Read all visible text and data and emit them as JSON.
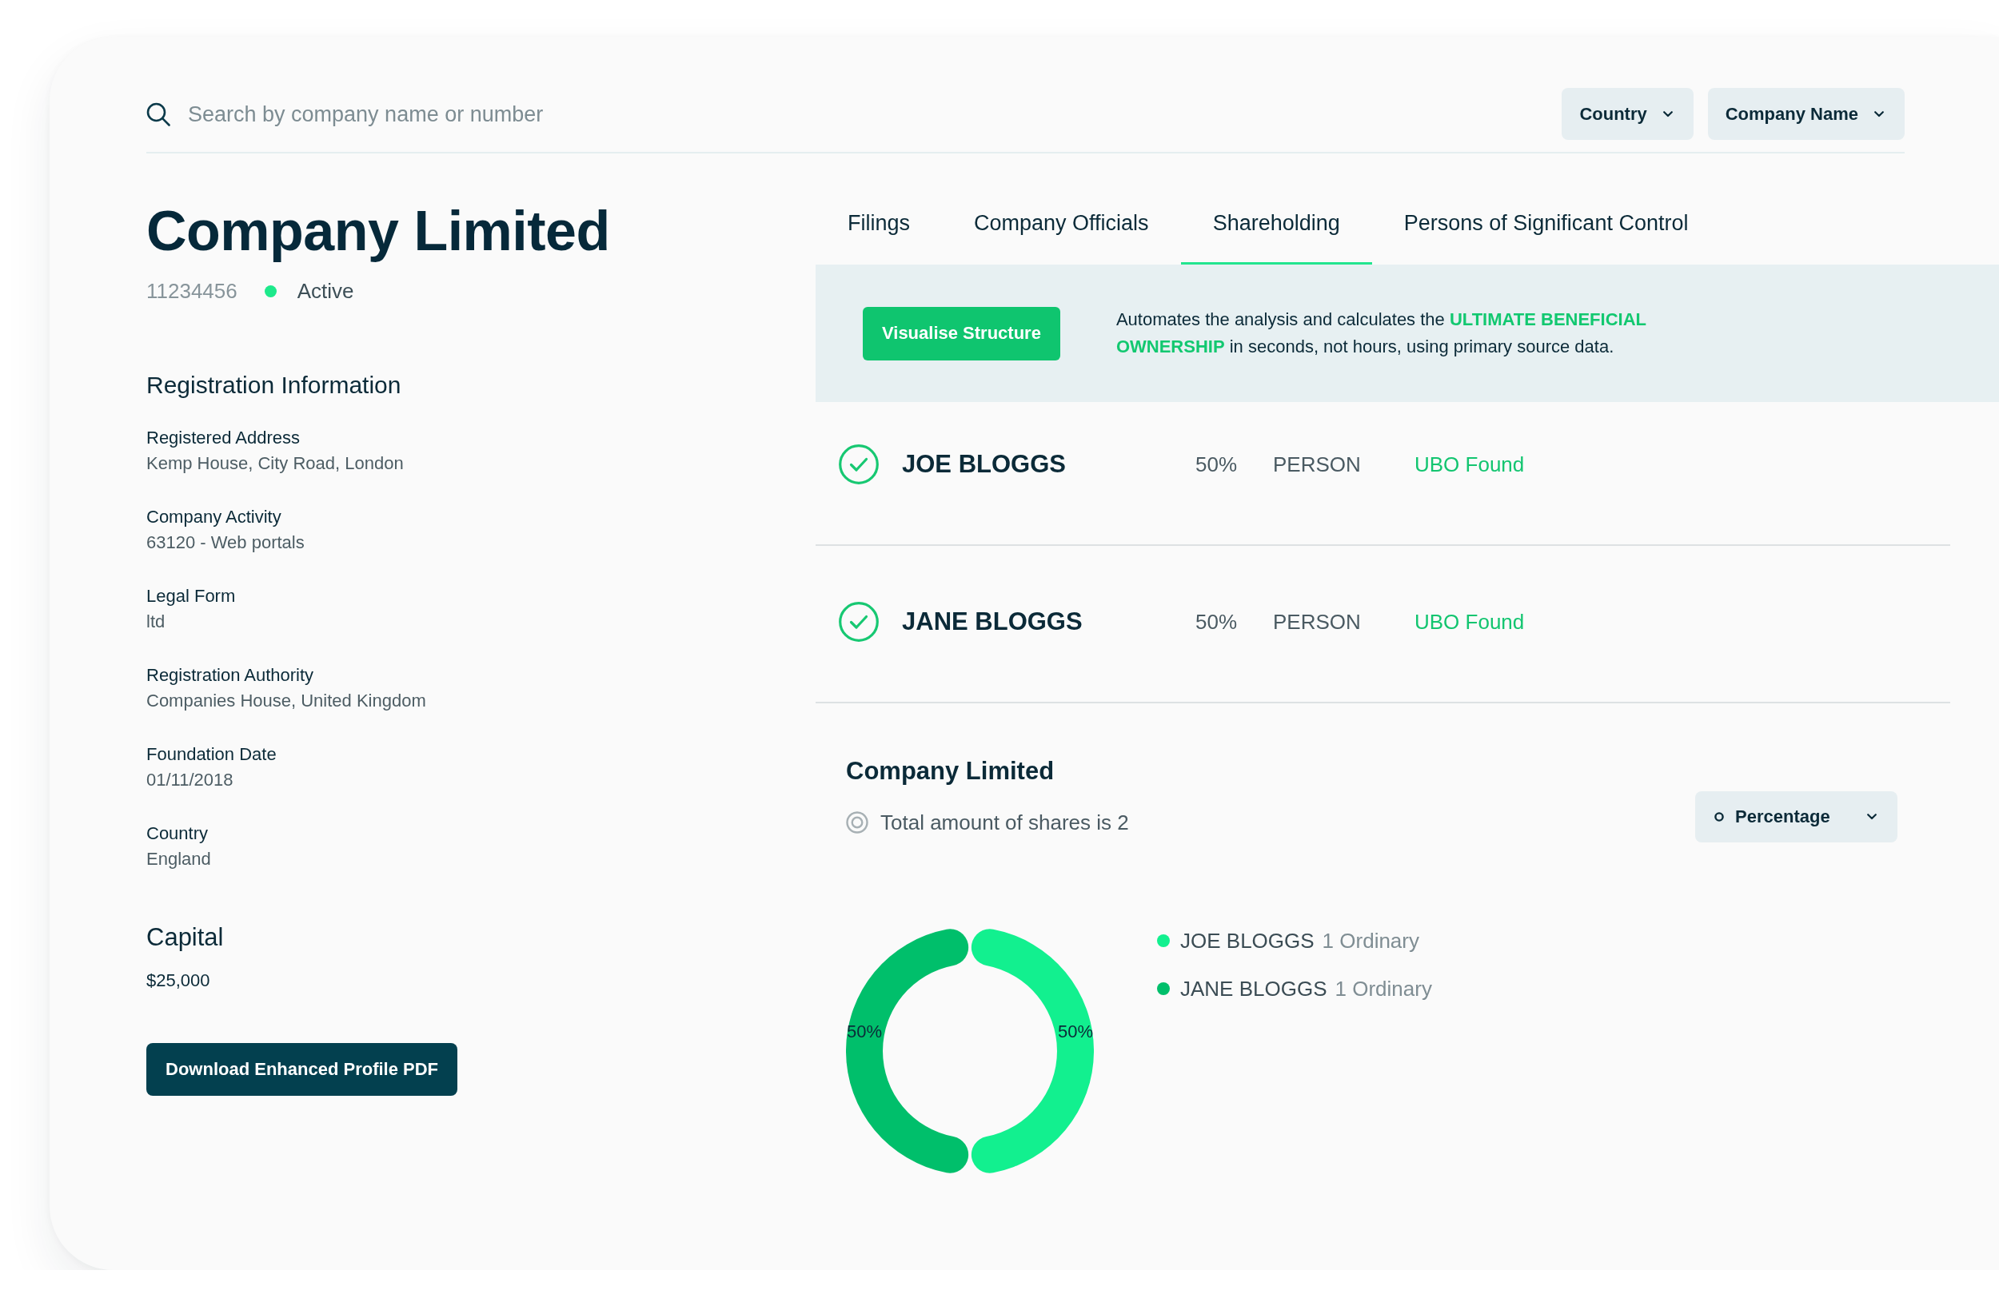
{
  "search": {
    "placeholder": "Search by company name or number"
  },
  "filters": [
    {
      "label": "Country"
    },
    {
      "label": "Company Name"
    }
  ],
  "company": {
    "name": "Company Limited",
    "number": "11234456",
    "status": {
      "label": "Active",
      "color": "#1de98b"
    }
  },
  "registration": {
    "title": "Registration Information",
    "fields": [
      {
        "label": "Registered Address",
        "value": "Kemp House, City Road, London"
      },
      {
        "label": "Company Activity",
        "value": "63120 - Web portals"
      },
      {
        "label": "Legal Form",
        "value": "ltd"
      },
      {
        "label": "Registration Authority",
        "value": "Companies House, United Kingdom"
      },
      {
        "label": "Foundation Date",
        "value": "01/11/2018"
      },
      {
        "label": "Country",
        "value": "England"
      }
    ]
  },
  "capital": {
    "title": "Capital",
    "value": "$25,000"
  },
  "download_button": "Download Enhanced Profile PDF",
  "tabs": [
    {
      "label": "Filings",
      "selected": false
    },
    {
      "label": "Company Officials",
      "selected": false
    },
    {
      "label": "Shareholding",
      "selected": true
    },
    {
      "label": "Persons of Significant Control",
      "selected": false
    }
  ],
  "banner": {
    "button": "Visualise Structure",
    "text": "Automates the analysis and calculates the **ULTIMATE BENEFICIAL OWNERSHIP** in seconds, not hours, using primary source data."
  },
  "shareholders": [
    {
      "name": "JOE BLOGGS",
      "share": "50%",
      "type": "PERSON",
      "status": "UBO Found"
    },
    {
      "name": "JANE BLOGGS",
      "share": "50%",
      "type": "PERSON",
      "status": "UBO Found"
    }
  ],
  "shares": {
    "title": "Company Limited",
    "total": "Total amount of shares is 2",
    "view_select": {
      "label": "Percentage"
    },
    "chart_data": {
      "type": "donut",
      "categories": [
        "JOE BLOGGS",
        "JANE BLOGGS"
      ],
      "values": [
        50,
        50
      ],
      "value_labels": [
        "50%",
        "50%"
      ]
    },
    "legend": [
      {
        "detail": "1 Ordinary",
        "color": "#12f08f"
      },
      {
        "detail": "1 Ordinary",
        "color": "#00bf6b"
      }
    ]
  }
}
